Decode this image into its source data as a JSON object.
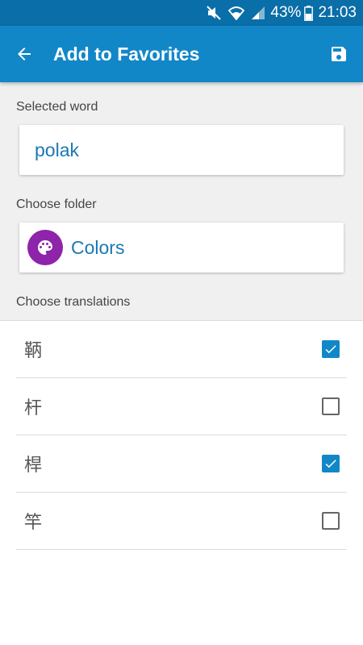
{
  "status_bar": {
    "battery_percent": "43%",
    "time": "21:03",
    "icons": [
      "mute-icon",
      "wifi-icon",
      "signal-icon",
      "battery-icon"
    ]
  },
  "app_bar": {
    "title": "Add to Favorites",
    "back_icon": "arrow-back-icon",
    "save_icon": "save-icon",
    "color": "#1287c8"
  },
  "selected_word": {
    "label": "Selected word",
    "value": "polak"
  },
  "folder": {
    "label": "Choose folder",
    "name": "Colors",
    "icon": "palette-icon",
    "icon_color": "#8e24aa"
  },
  "translations": {
    "label": "Choose translations",
    "items": [
      {
        "text": "鞆",
        "checked": true
      },
      {
        "text": "杆",
        "checked": false
      },
      {
        "text": "桿",
        "checked": true
      },
      {
        "text": "竿",
        "checked": false
      }
    ]
  }
}
